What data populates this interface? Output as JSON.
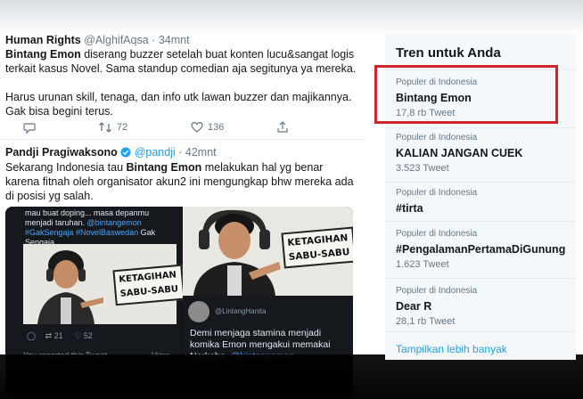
{
  "tweet1": {
    "name": "Human Rights",
    "handle": "@AlghifAqsa",
    "time": "34mnt",
    "highlight": "Bintang Emon",
    "text_a": " diserang buzzer setelah buat konten lucu&sangat logis terkait kasus Novel. Sama standup comedian aja segitunya ya mereka.",
    "text_b": "Harus urunan skill, tenaga, dan info utk lawan buzzer dan majikannya. Gak bisa begini terus.",
    "retweets": "72",
    "likes": "136"
  },
  "tweet2": {
    "name": "Pandji Pragiwaksono",
    "handle": "@pandji",
    "time": "42mnt",
    "text_a": "Sekarang Indonesia tau ",
    "highlight": "Bintang Emon",
    "text_b": " melakukan hal yg benar karena fitnah oleh organisator akun2 ini mengungkap bhw mereka ada di posisi yg salah.",
    "media": {
      "left_caption_a": "mau buat doping... masa depanmu",
      "left_caption_b": "menjadi taruhan. ",
      "left_tag1": "@bintangemon",
      "left_tags": "#GakSengaja #NovelBaswedan",
      "left_caption_c": " Gak Sengaja",
      "sign_left": "KETAGIHAN\nSABU-SABU",
      "sign_right": "KETAGIHAN\nSABU-SABU",
      "left_count1": "21",
      "left_count2": "52",
      "reported": "You reported this Tweet.",
      "view": "View",
      "right_user": "@LintangHanita",
      "right_text": "Demi menjaga stamina menjadi komika Emon mengakui memakai Narkoba. ",
      "right_mention": "@bintangemon"
    }
  },
  "trends": {
    "title": "Tren untuk Anda",
    "items": [
      {
        "context": "Populer di Indonesia",
        "name": "Bintang Emon",
        "count": "17,8 rb Tweet"
      },
      {
        "context": "Populer di Indonesia",
        "name": "KALIAN JANGAN CUEK",
        "count": "3.523 Tweet"
      },
      {
        "context": "Populer di Indonesia",
        "name": "#tirta",
        "count": ""
      },
      {
        "context": "Populer di Indonesia",
        "name": "#PengalamanPertamaDiGunung",
        "count": "1.623 Tweet"
      },
      {
        "context": "Populer di Indonesia",
        "name": "Dear R",
        "count": "28,1 rb Tweet"
      }
    ],
    "show_more": "Tampilkan lebih banyak"
  },
  "colors": {
    "accent": "#1da1f2",
    "highlight_box": "#d2232a",
    "muted": "#657786"
  }
}
